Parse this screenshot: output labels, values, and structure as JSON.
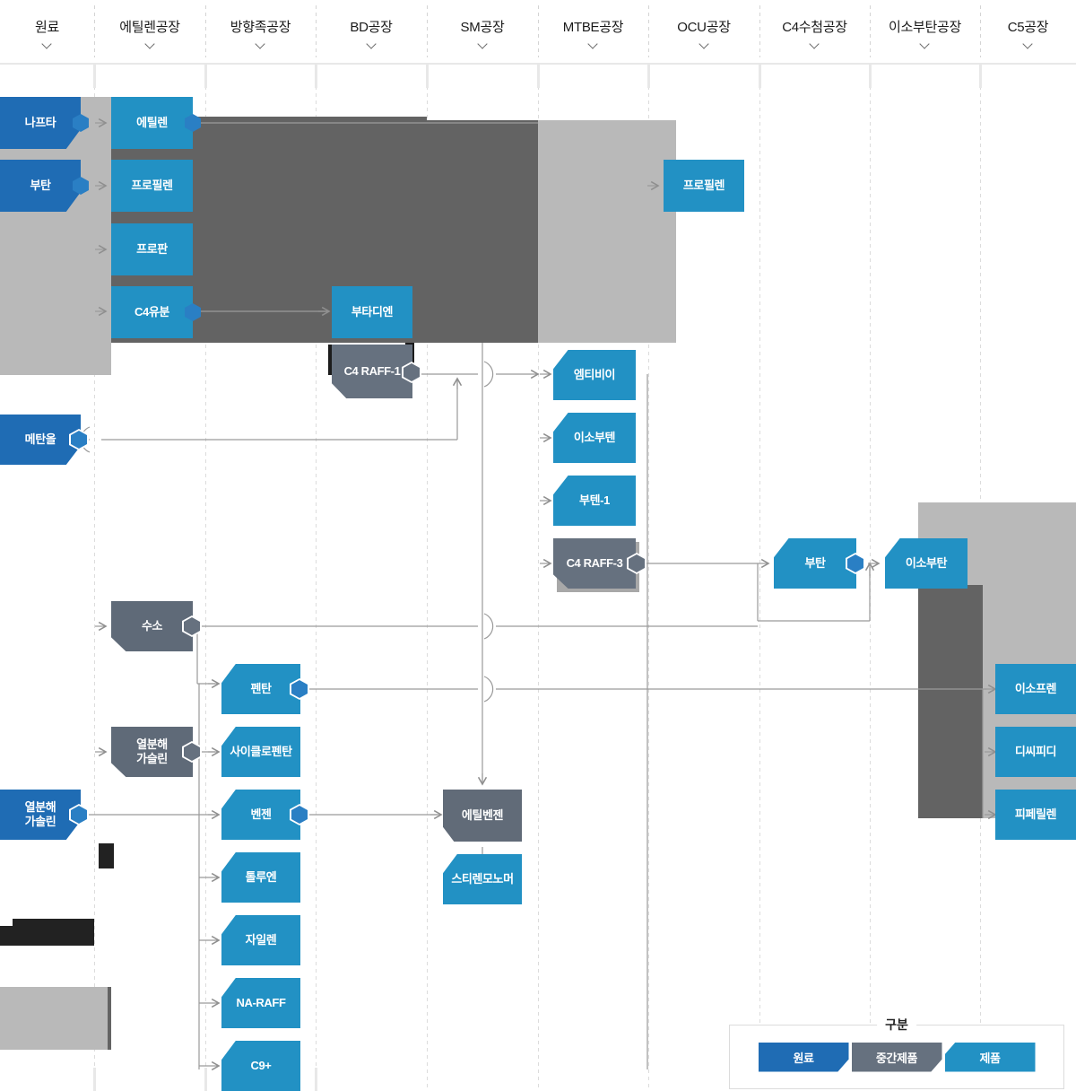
{
  "header": {
    "columns": [
      {
        "label": "원료",
        "chevron": "chevron-down-icon"
      },
      {
        "label": "에틸렌공장",
        "chevron": "chevron-down-icon"
      },
      {
        "label": "방향족공장",
        "chevron": "chevron-down-icon"
      },
      {
        "label": "BD공장",
        "chevron": "chevron-down-icon"
      },
      {
        "label": "SM공장",
        "chevron": "chevron-down-icon"
      },
      {
        "label": "MTBE공장",
        "chevron": "chevron-down-icon"
      },
      {
        "label": "OCU공장",
        "chevron": "chevron-down-icon"
      },
      {
        "label": "C4수첨공장",
        "chevron": "chevron-down-icon"
      },
      {
        "label": "이소부탄공장",
        "chevron": "chevron-down-icon"
      },
      {
        "label": "C5공장",
        "chevron": "chevron-down-icon"
      }
    ]
  },
  "nodes": {
    "naphtha": "나프타",
    "butane_feed": "부탄",
    "methanol": "메탄올",
    "pyrolysis_feed": "열분해\n가솔린",
    "ethylene": "에틸렌",
    "propylene": "프로필렌",
    "propane": "프로판",
    "c4_fraction": "C4유분",
    "hydrogen": "수소",
    "pygas_mid": "열분해\n가슬린",
    "butadiene": "부타디엔",
    "c4_raff_1": "C4 RAFF-1",
    "pentane": "펜탄",
    "cyclopentane": "사이클로펜탄",
    "benzene": "벤젠",
    "toluene": "톨루엔",
    "xylene": "자일렌",
    "na_raff": "NA-RAFF",
    "c9plus": "C9+",
    "ethylbenzene": "에틸벤젠",
    "styrene": "스티렌모노머",
    "mtbe": "엠티비이",
    "isobutene": "이소부텐",
    "butene_1": "부텐-1",
    "c4_raff_3": "C4 RAFF-3",
    "ocu_propylene": "프로필렌",
    "butane_prod": "부탄",
    "isobutane": "이소부탄",
    "isoprene": "이소프렌",
    "dcpd": "디씨피디",
    "piperylene": "피페릴렌"
  },
  "legend": {
    "title": "구분",
    "items": [
      {
        "label": "원료",
        "type": "raw"
      },
      {
        "label": "중간제품",
        "type": "intermediate"
      },
      {
        "label": "제품",
        "type": "product"
      }
    ]
  },
  "colors": {
    "raw": "#1f6cb4",
    "product": "#2291c4",
    "intermediate": "#66717f",
    "band_dark": "#636363",
    "band_light": "#b9b9b9",
    "line": "#9a9a9a",
    "guide": "#dcdcdc"
  }
}
